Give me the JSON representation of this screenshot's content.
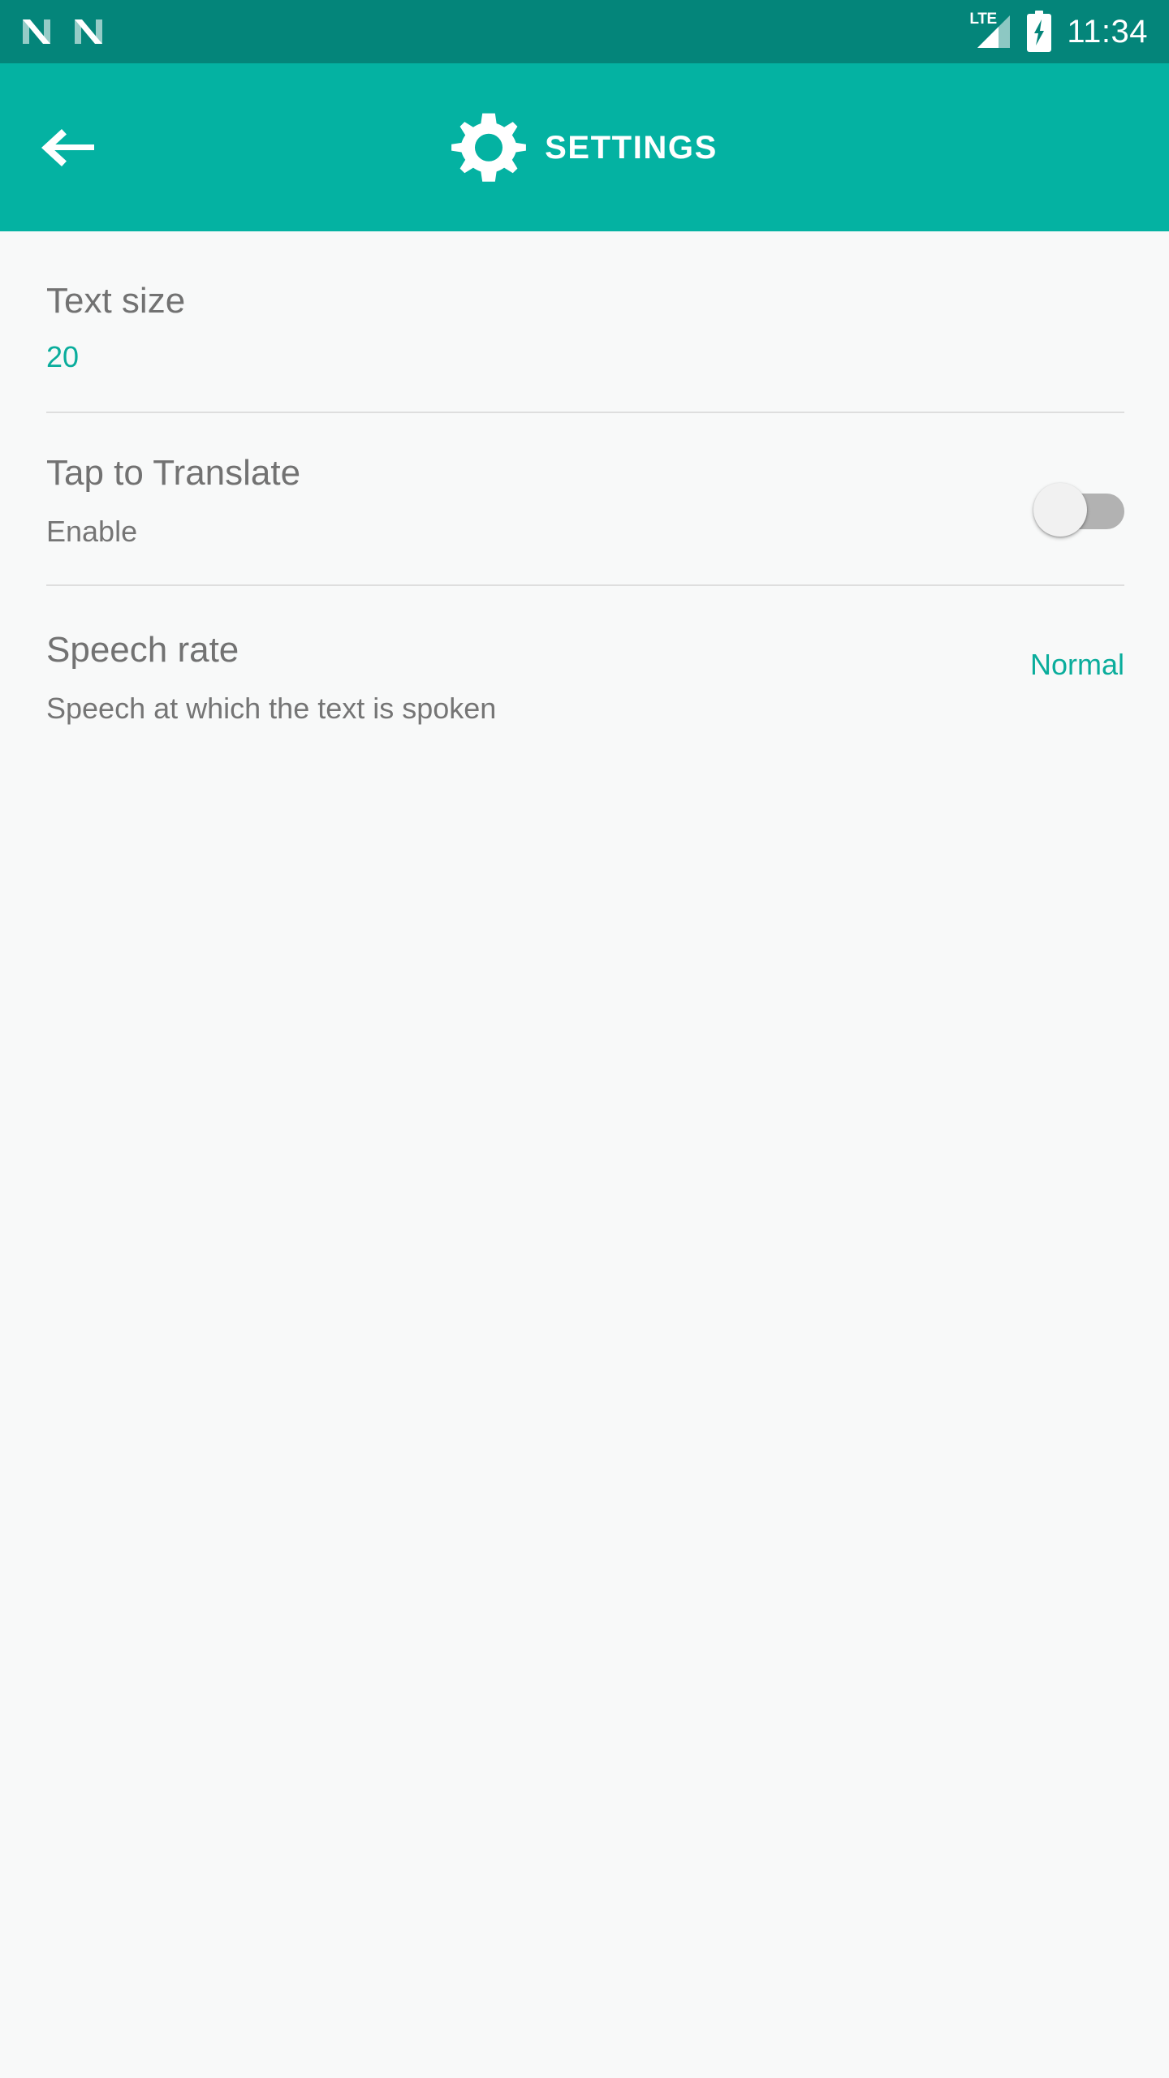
{
  "status_bar": {
    "notification_icons": [
      "n-logo-icon",
      "n-logo-icon"
    ],
    "network_label": "LTE",
    "signal_icon": "signal-bars-icon",
    "battery_icon": "battery-charging-icon",
    "time": "11:34",
    "background_color": "#04857a",
    "foreground_color": "#ffffff"
  },
  "app_bar": {
    "back_icon": "arrow-left-icon",
    "gear_icon": "gear-icon",
    "title": "SETTINGS",
    "background_color": "#04b2a2",
    "foreground_color": "#ffffff"
  },
  "settings": {
    "accent_color": "#0aad9c",
    "title_color": "#727272",
    "background_color": "#f8f9f9",
    "divider_color": "#dedede",
    "rows": [
      {
        "title": "Text size",
        "value": "20",
        "value_style": "accent",
        "has_switch": false
      },
      {
        "title": "Tap to Translate",
        "subtitle": "Enable",
        "has_switch": true,
        "switch_state": "off"
      },
      {
        "title": "Speech rate",
        "subtitle": "Speech at which the text is spoken",
        "value": "Normal",
        "value_style": "accent",
        "has_switch": false
      }
    ]
  }
}
